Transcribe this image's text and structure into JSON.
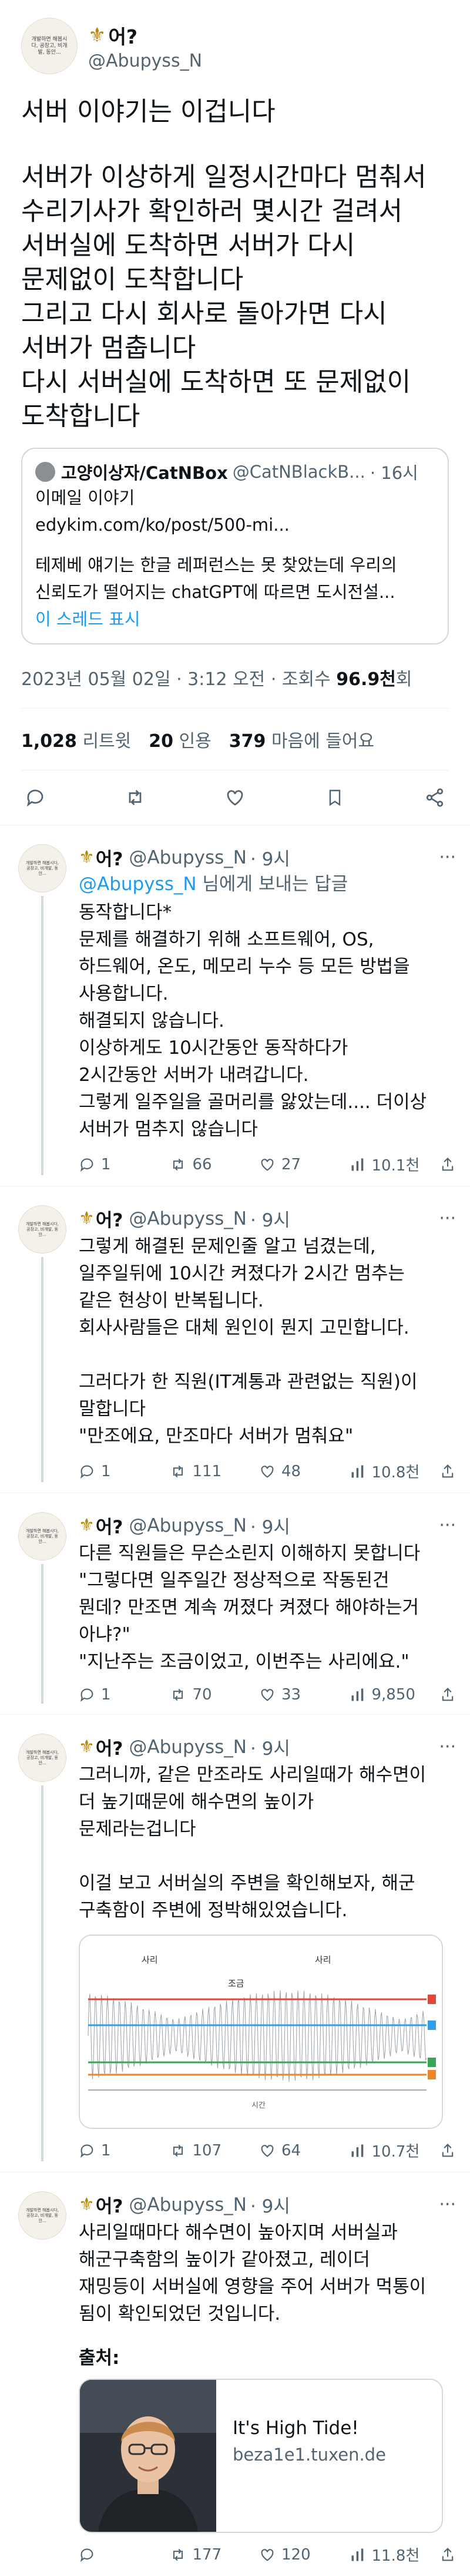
{
  "author": {
    "avatar_text": "개발하면 해봅시다, 공장고, 비개발, 동안...",
    "display_name": "어?",
    "handle": "@Abupyss_N"
  },
  "tweet": {
    "headline": "서버 이야기는 이겁니다",
    "body": "서버가 이상하게 일정시간마다 멈춰서\n수리기사가 확인하러 몇시간 걸려서\n서버실에 도착하면 서버가 다시\n문제없이 도착합니다\n그리고 다시 회사로 돌아가면 다시\n서버가 멈춥니다\n다시 서버실에 도착하면 또 문제없이\n도착합니다",
    "quote": {
      "name": "고양이상자/CatNBox",
      "handle": "@CatNBlackB...",
      "time": "· 16시",
      "line1": "이메일 이야기",
      "line2": "edykim.com/ko/post/500-mi...",
      "line3": "테제베 얘기는 한글 레퍼런스는 못 찾았는데 우리의",
      "line4": "신뢰도가 떨어지는 chatGPT에 따르면 도시전설...",
      "show_thread": "이 스레드 표시"
    },
    "timestamp": "2023년 05월 02일 · 3:12 오전 · 조회수",
    "views": "96.9천",
    "views_suffix": "회",
    "retweets_num": "1,028",
    "retweets_label": "리트윗",
    "quotes_num": "20",
    "quotes_label": "인용",
    "likes_num": "379",
    "likes_label": "마음에 들어요"
  },
  "replies": [
    {
      "name": "어?",
      "handle": "@Abupyss_N",
      "time": "· 9시",
      "reply_to_mention": "@Abupyss_N",
      "reply_to_suffix": " 님에게 보내는 답글",
      "text": "동작합니다*\n문제를 해결하기 위해 소프트웨어, OS,\n하드웨어, 온도, 메모리 누수 등 모든 방법을\n사용합니다.\n해결되지 않습니다.\n이상하게도 10시간동안 동작하다가\n2시간동안 서버가 내려갑니다.\n그렇게 일주일을 골머리를 앓았는데.... 더이상\n서버가 멈추지 않습니다",
      "reply_count": "1",
      "retweet_count": "66",
      "like_count": "27",
      "view_count": "10.1천"
    },
    {
      "name": "어?",
      "handle": "@Abupyss_N",
      "time": "· 9시",
      "text": "그렇게 해결된 문제인줄 알고 넘겼는데,\n일주일뒤에 10시간 켜졌다가 2시간 멈추는\n같은 현상이 반복됩니다.\n회사사람들은 대체 원인이 뭔지 고민합니다.\n\n그러다가 한 직원(IT계통과 관련없는 직원)이\n말합니다\n\"만조에요, 만조마다 서버가 멈춰요\"",
      "reply_count": "1",
      "retweet_count": "111",
      "like_count": "48",
      "view_count": "10.8천"
    },
    {
      "name": "어?",
      "handle": "@Abupyss_N",
      "time": "· 9시",
      "text": "다른 직원들은 무슨소린지 이해하지 못합니다\n\"그렇다면 일주일간 정상적으로 작동된건\n뭔데? 만조면 계속 꺼졌다 켜졌다 해야하는거\n아냐?\"\n\"지난주는 조금이었고, 이번주는 사리에요.\"",
      "reply_count": "1",
      "retweet_count": "70",
      "like_count": "33",
      "view_count": "9,850"
    },
    {
      "name": "어?",
      "handle": "@Abupyss_N",
      "time": "· 9시",
      "text": "그러니까, 같은 만조라도 사리일때가 해수면이\n더 높기때문에 해수면의 높이가\n문제라는겁니다\n\n이걸 보고 서버실의 주변을 확인해보자, 해군\n구축함이 주변에 정박해있었습니다.",
      "chart_label_spring1": "사리",
      "chart_label_neap": "조금",
      "chart_label_spring2": "사리",
      "chart_label_x": "시간",
      "reply_count": "1",
      "retweet_count": "107",
      "like_count": "64",
      "view_count": "10.7천"
    },
    {
      "name": "어?",
      "handle": "@Abupyss_N",
      "time": "· 9시",
      "text": "사리일때마다 해수면이 높아지며 서버실과\n해군구축함의 높이가 같아졌고, 레이더\n재밍등이 서버실에 영향을 주어 서버가 먹통이\n됨이 확인되었던 것입니다.",
      "source_label": "출처:",
      "link_title": "It's High Tide!",
      "link_domain": "beza1e1.tuxen.de",
      "reply_count": "",
      "retweet_count": "177",
      "like_count": "120",
      "view_count": "11.8천"
    }
  ],
  "colors": {
    "accent": "#1d9bf0",
    "muted": "#536471",
    "chart_red": "#e0483a",
    "chart_blue": "#2f9fe6",
    "chart_green": "#3aa655",
    "chart_orange": "#e8872b"
  }
}
